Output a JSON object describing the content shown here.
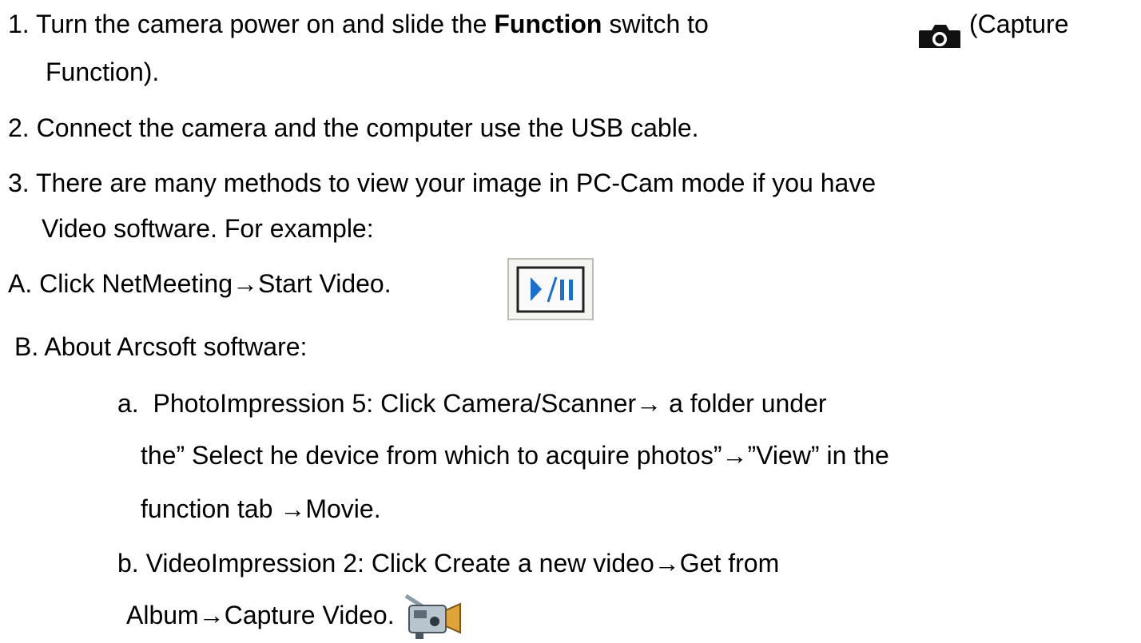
{
  "steps": {
    "s1": {
      "num": "1.",
      "pre": "Turn the camera power on and slide the",
      "bold": "Function",
      "post": "switch to",
      "tail": "(Capture",
      "line2": "Function)."
    },
    "s2": {
      "num": "2.",
      "text": "Connect the camera and the computer use the USB cable."
    },
    "s3": {
      "num": "3.",
      "line1": "There are many methods to view your image in PC-Cam mode if you have",
      "line2": "Video software. For example:"
    }
  },
  "subA": {
    "prefix": "A.",
    "text": "Click NetMeeting→Start Video."
  },
  "subB": {
    "prefix": "B.",
    "text": "About Arcsoft software:"
  },
  "itemA": {
    "prefix": "a.",
    "line1": "PhotoImpression 5: Click Camera/Scanner→ a folder under",
    "line2": "the” Select he device from which to acquire photos”→”View” in the",
    "line3": "function tab →Movie."
  },
  "itemB": {
    "prefix": "b.",
    "line1": "VideoImpression 2: Click Create a new video→Get from",
    "line2": "Album→Capture Video."
  },
  "icons": {
    "camera": "camera-icon",
    "play_pause": "play-pause-icon",
    "video_camera": "video-camera-icon"
  },
  "colors": {
    "text": "#000000",
    "play_button_blue": "#1b6fd1"
  }
}
